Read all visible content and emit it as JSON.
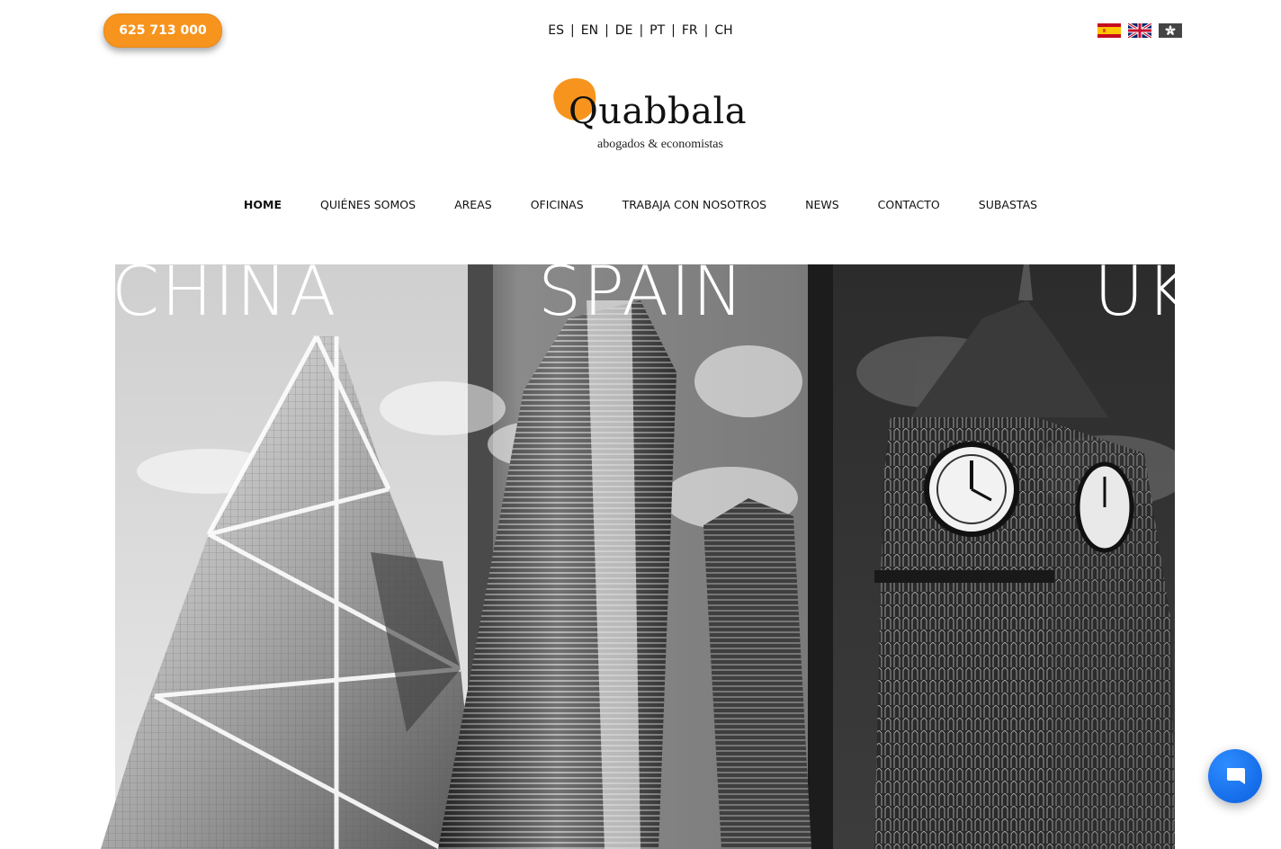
{
  "header": {
    "phone_label": "625 713 000",
    "languages": [
      "ES",
      "EN",
      "DE",
      "PT",
      "FR",
      "CH"
    ],
    "flags": [
      "spain-flag-icon",
      "uk-flag-icon",
      "hong-kong-flag-icon"
    ]
  },
  "logo": {
    "brand": "Quabbala",
    "tagline": "abogados & economistas",
    "accent_color": "#f7941d"
  },
  "nav": {
    "items": [
      "HOME",
      "QUIÉNES SOMOS",
      "AREAS",
      "OFICINAS",
      "TRABAJA CON NOSOTROS",
      "NEWS",
      "CONTACTO",
      "SUBASTAS"
    ],
    "active": "HOME"
  },
  "hero": {
    "labels": [
      "CHINA",
      "SPAIN",
      "UK"
    ]
  },
  "chat": {
    "icon": "chat-bubble-icon",
    "color": "#1a73e8"
  }
}
